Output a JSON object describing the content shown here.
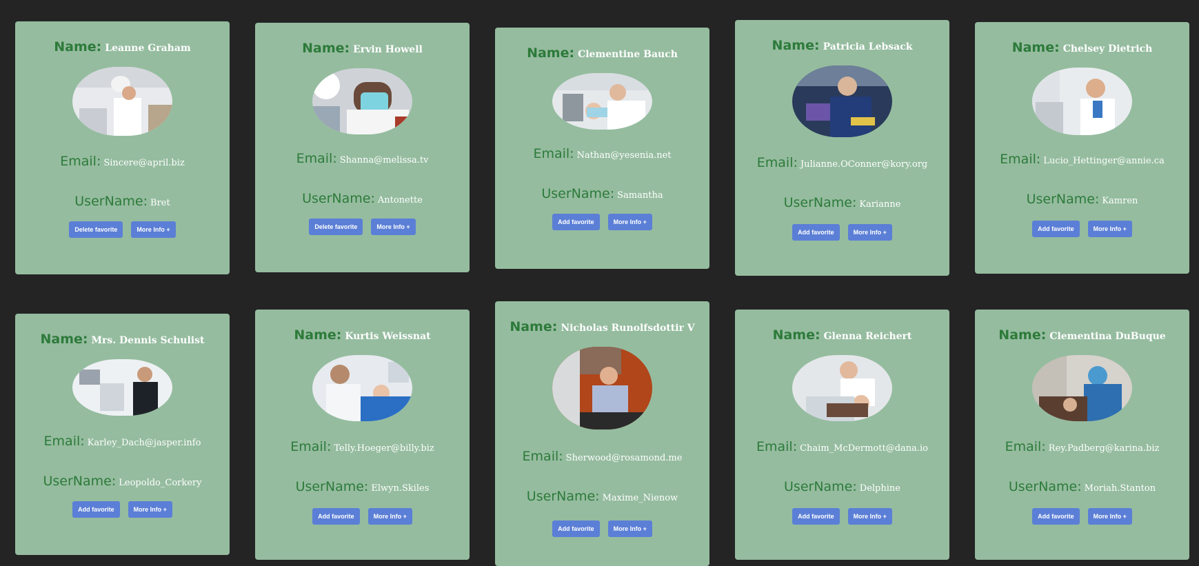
{
  "labels": {
    "name": "Name:",
    "email": "Email:",
    "username": "UserName:",
    "more_info": "More Info +"
  },
  "cards": [
    {
      "name": "Leanne Graham",
      "email": "Sincere@april.biz",
      "username": "Bret",
      "fav_label": "Delete favorite"
    },
    {
      "name": "Ervin Howell",
      "email": "Shanna@melissa.tv",
      "username": "Antonette",
      "fav_label": "Delete favorite"
    },
    {
      "name": "Clementine Bauch",
      "email": "Nathan@yesenia.net",
      "username": "Samantha",
      "fav_label": "Add favorite"
    },
    {
      "name": "Patricia Lebsack",
      "email": "Julianne.OConner@kory.org",
      "username": "Karianne",
      "fav_label": "Add favorite"
    },
    {
      "name": "Chelsey Dietrich",
      "email": "Lucio_Hettinger@annie.ca",
      "username": "Kamren",
      "fav_label": "Add favorite"
    },
    {
      "name": "Mrs. Dennis Schulist",
      "email": "Karley_Dach@jasper.info",
      "username": "Leopoldo_Corkery",
      "fav_label": "Add favorite"
    },
    {
      "name": "Kurtis Weissnat",
      "email": "Telly.Hoeger@billy.biz",
      "username": "Elwyn.Skiles",
      "fav_label": "Add favorite"
    },
    {
      "name": "Nicholas Runolfsdottir V",
      "email": "Sherwood@rosamond.me",
      "username": "Maxime_Nienow",
      "fav_label": "Add favorite"
    },
    {
      "name": "Glenna Reichert",
      "email": "Chaim_McDermott@dana.io",
      "username": "Delphine",
      "fav_label": "Add favorite"
    },
    {
      "name": "Clementina DuBuque",
      "email": "Rey.Padberg@karina.biz",
      "username": "Moriah.Stanton",
      "fav_label": "Add favorite"
    }
  ],
  "colors": {
    "page_background": "#242424",
    "card_background": "#95bc9f",
    "label_green": "#2d7a3a",
    "button_blue": "#5b7fd6"
  }
}
